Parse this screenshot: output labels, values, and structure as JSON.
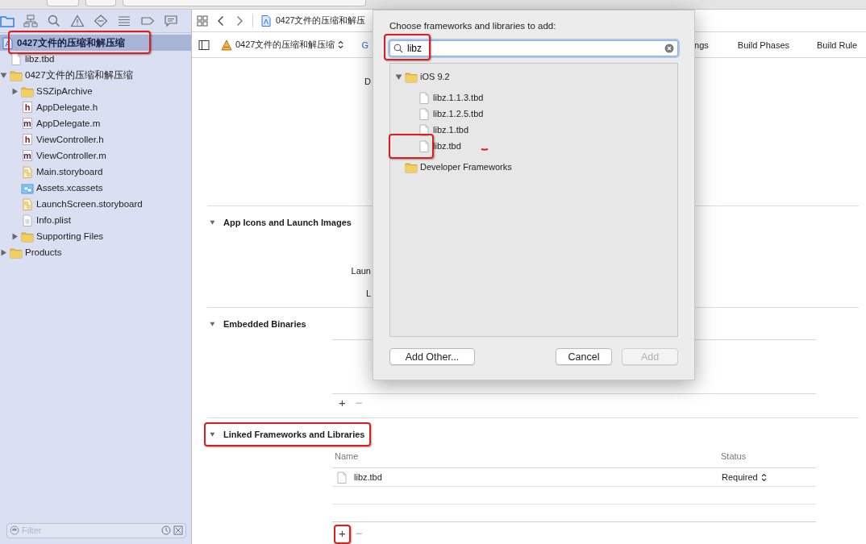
{
  "navigator_tabs": [
    {
      "kind": "folder",
      "selected": true
    },
    {
      "kind": "hierarchy",
      "selected": false
    },
    {
      "kind": "search",
      "selected": false
    },
    {
      "kind": "warning",
      "selected": false
    },
    {
      "kind": "diamond",
      "selected": false
    },
    {
      "kind": "list",
      "selected": false
    },
    {
      "kind": "tag",
      "selected": false
    },
    {
      "kind": "comment",
      "selected": false
    }
  ],
  "project_tree": [
    {
      "label": "0427文件的压缩和解压缩",
      "kind": "project",
      "selected": true,
      "annotated": true,
      "children": [
        {
          "label": "libz.tbd",
          "kind": "blank",
          "selected": false
        },
        {
          "label": "0427文件的压缩和解压缩",
          "kind": "folder",
          "selected": false,
          "expanded": true,
          "children": [
            {
              "label": "SSZipArchive",
              "kind": "folder",
              "selected": false,
              "expanded": false
            },
            {
              "label": "AppDelegate.h",
              "kind": "letter",
              "icon_letter": "h",
              "selected": false
            },
            {
              "label": "AppDelegate.m",
              "kind": "letter",
              "icon_letter": "m",
              "selected": false
            },
            {
              "label": "ViewController.h",
              "kind": "letter",
              "icon_letter": "h",
              "selected": false
            },
            {
              "label": "ViewController.m",
              "kind": "letter",
              "icon_letter": "m",
              "selected": false
            },
            {
              "label": "Main.storyboard",
              "kind": "storyboard",
              "selected": false
            },
            {
              "label": "Assets.xcassets",
              "kind": "assets",
              "selected": false
            },
            {
              "label": "LaunchScreen.storyboard",
              "kind": "storyboard",
              "selected": false
            },
            {
              "label": "Info.plist",
              "kind": "plist",
              "selected": false
            },
            {
              "label": "Supporting Files",
              "kind": "folder",
              "selected": false,
              "expanded": false
            }
          ]
        },
        {
          "label": "Products",
          "kind": "folder",
          "selected": false,
          "expanded": false
        }
      ]
    }
  ],
  "filter": {
    "placeholder": "Filter"
  },
  "jump_bar": {
    "path": "0427文件的压缩和解压"
  },
  "editor_bar": {
    "target": "0427文件的压缩和解压缩",
    "tabs": [
      {
        "label": "G",
        "selected": true
      },
      {
        "label": "ngs",
        "selected": false
      },
      {
        "label": "Build Phases",
        "selected": false
      },
      {
        "label": "Build Rule",
        "selected": false
      }
    ]
  },
  "identity": {
    "labels": [
      "D"
    ]
  },
  "app_icons": {
    "title": "App Icons and Launch Images",
    "expanded": true,
    "labels": [
      "Laun",
      "L"
    ]
  },
  "embedded_binaries": {
    "title": "Embedded Binaries",
    "expanded": true,
    "add_button": {
      "label": "+"
    },
    "remove_button": "−"
  },
  "linked_frameworks": {
    "title": "Linked Frameworks and Libraries",
    "expanded": true,
    "annotated": true,
    "columns": [
      "Name",
      "Status"
    ],
    "rows": [
      {
        "name": "libz.tbd",
        "status": "Required"
      }
    ],
    "add_button": {
      "label": "+",
      "annotated": true
    },
    "remove_button": "−"
  },
  "dialog": {
    "title": "Choose frameworks and libraries to add:",
    "search": {
      "value": "libz",
      "annotated": true
    },
    "tree": [
      {
        "label": "iOS 9.2",
        "kind": "folder",
        "expanded": true,
        "children": [
          {
            "label": "libz.1.1.3.tbd",
            "kind": "blank",
            "annotated": false
          },
          {
            "label": "libz.1.2.5.tbd",
            "kind": "blank",
            "annotated": false
          },
          {
            "label": "libz.1.tbd",
            "kind": "blank",
            "annotated": false
          },
          {
            "label": "libz.tbd",
            "kind": "blank",
            "annotated": true,
            "scribble": true
          }
        ]
      },
      {
        "label": "Developer Frameworks",
        "kind": "folder"
      }
    ],
    "buttons": [
      {
        "label": "Add Other...",
        "disabled": false,
        "kind": "left"
      },
      {
        "label": "Cancel",
        "disabled": false,
        "kind": "right"
      },
      {
        "label": "Add",
        "disabled": true,
        "kind": "right"
      }
    ]
  }
}
